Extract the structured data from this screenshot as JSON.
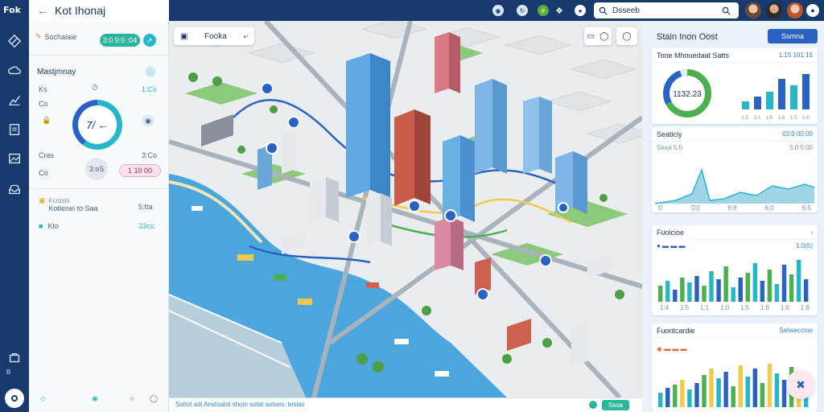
{
  "app": {
    "brand": "Fok",
    "title": "Kot Ihonaj"
  },
  "rail": {
    "icons": [
      "diamond-icon",
      "cloud-icon",
      "chart-icon",
      "document-icon",
      "image-icon",
      "inbox-icon"
    ],
    "version": "B"
  },
  "topbar": {
    "icons": [
      "eye-icon",
      "refresh-icon",
      "bolt-icon",
      "circle-icon"
    ],
    "search_value": "Dsseeb"
  },
  "left_panel": {
    "header_label": "Sochalaie",
    "header_badge": "3:0 9:0 :04",
    "section_title": "Mastjmnay",
    "rows": [
      {
        "label": "Ks",
        "value": "1:Cs"
      },
      {
        "label": "Co",
        "value": ""
      },
      {
        "label": "Cras",
        "value": "3:Co"
      },
      {
        "label": "Co",
        "value": ""
      }
    ],
    "gauge_value": "7/ ←",
    "ring_pill": "3:oS",
    "pink_pill": "1 10 00",
    "list": [
      {
        "title": "Kcotsts",
        "sub": "Kotlenei to Saa",
        "value": "5:tta"
      },
      {
        "title": "Kto",
        "sub": "",
        "value": "33cs:"
      }
    ]
  },
  "map": {
    "search_label": "Fooka",
    "bottom_text": "Sotlot adi Anstoatoi shoin sotat astoes: teslas",
    "bottom_btn": "Ssoa"
  },
  "right_panel": {
    "title": "Stain Inon Oost",
    "title_btn": "Ssmna",
    "cards": [
      {
        "title": "Tooe Mhouedaat Satts",
        "right": "1:15 101:15",
        "donut_value": "1132.23",
        "bars": [
          10,
          16,
          22,
          38,
          30,
          44
        ],
        "labels": [
          "1:5",
          "1:1",
          "1:5",
          "1:5",
          "1:5",
          "1:5"
        ]
      },
      {
        "title": "Seaticiy",
        "right": "03:0 00:00",
        "sub_left": "Seaa 5:0",
        "sub_right": "5:0 5:00",
        "xlabels": [
          "D",
          "D3",
          "6:8",
          "6:0",
          "6:5"
        ]
      },
      {
        "title": "Fuolcioe",
        "sub_left": "",
        "sub_right": "1:0(5)",
        "bars": [
          20,
          26,
          15,
          30,
          24,
          32,
          20,
          38,
          28,
          44,
          18,
          30,
          36,
          48,
          26,
          40,
          22,
          46,
          34,
          52,
          28
        ],
        "xlabels": [
          "1:4",
          "1:5",
          "1:1",
          "1:0",
          "1:5",
          "1:8",
          "1:6",
          "1:8"
        ]
      },
      {
        "title": "Fuontcardie",
        "right": "Sahsecctoo",
        "bars": [
          18,
          24,
          28,
          34,
          22,
          30,
          40,
          48,
          36,
          44,
          26,
          52,
          38,
          48,
          30,
          54,
          42,
          34,
          50,
          46,
          28
        ],
        "xlabels": [
          "1:5",
          "1:5",
          "1:5",
          "1:5",
          "1:5"
        ]
      }
    ]
  },
  "colors": {
    "navy": "#17396b",
    "teal": "#27b6c9",
    "green": "#4caf50",
    "blue": "#2a62c2",
    "water": "#4aa6dd"
  }
}
